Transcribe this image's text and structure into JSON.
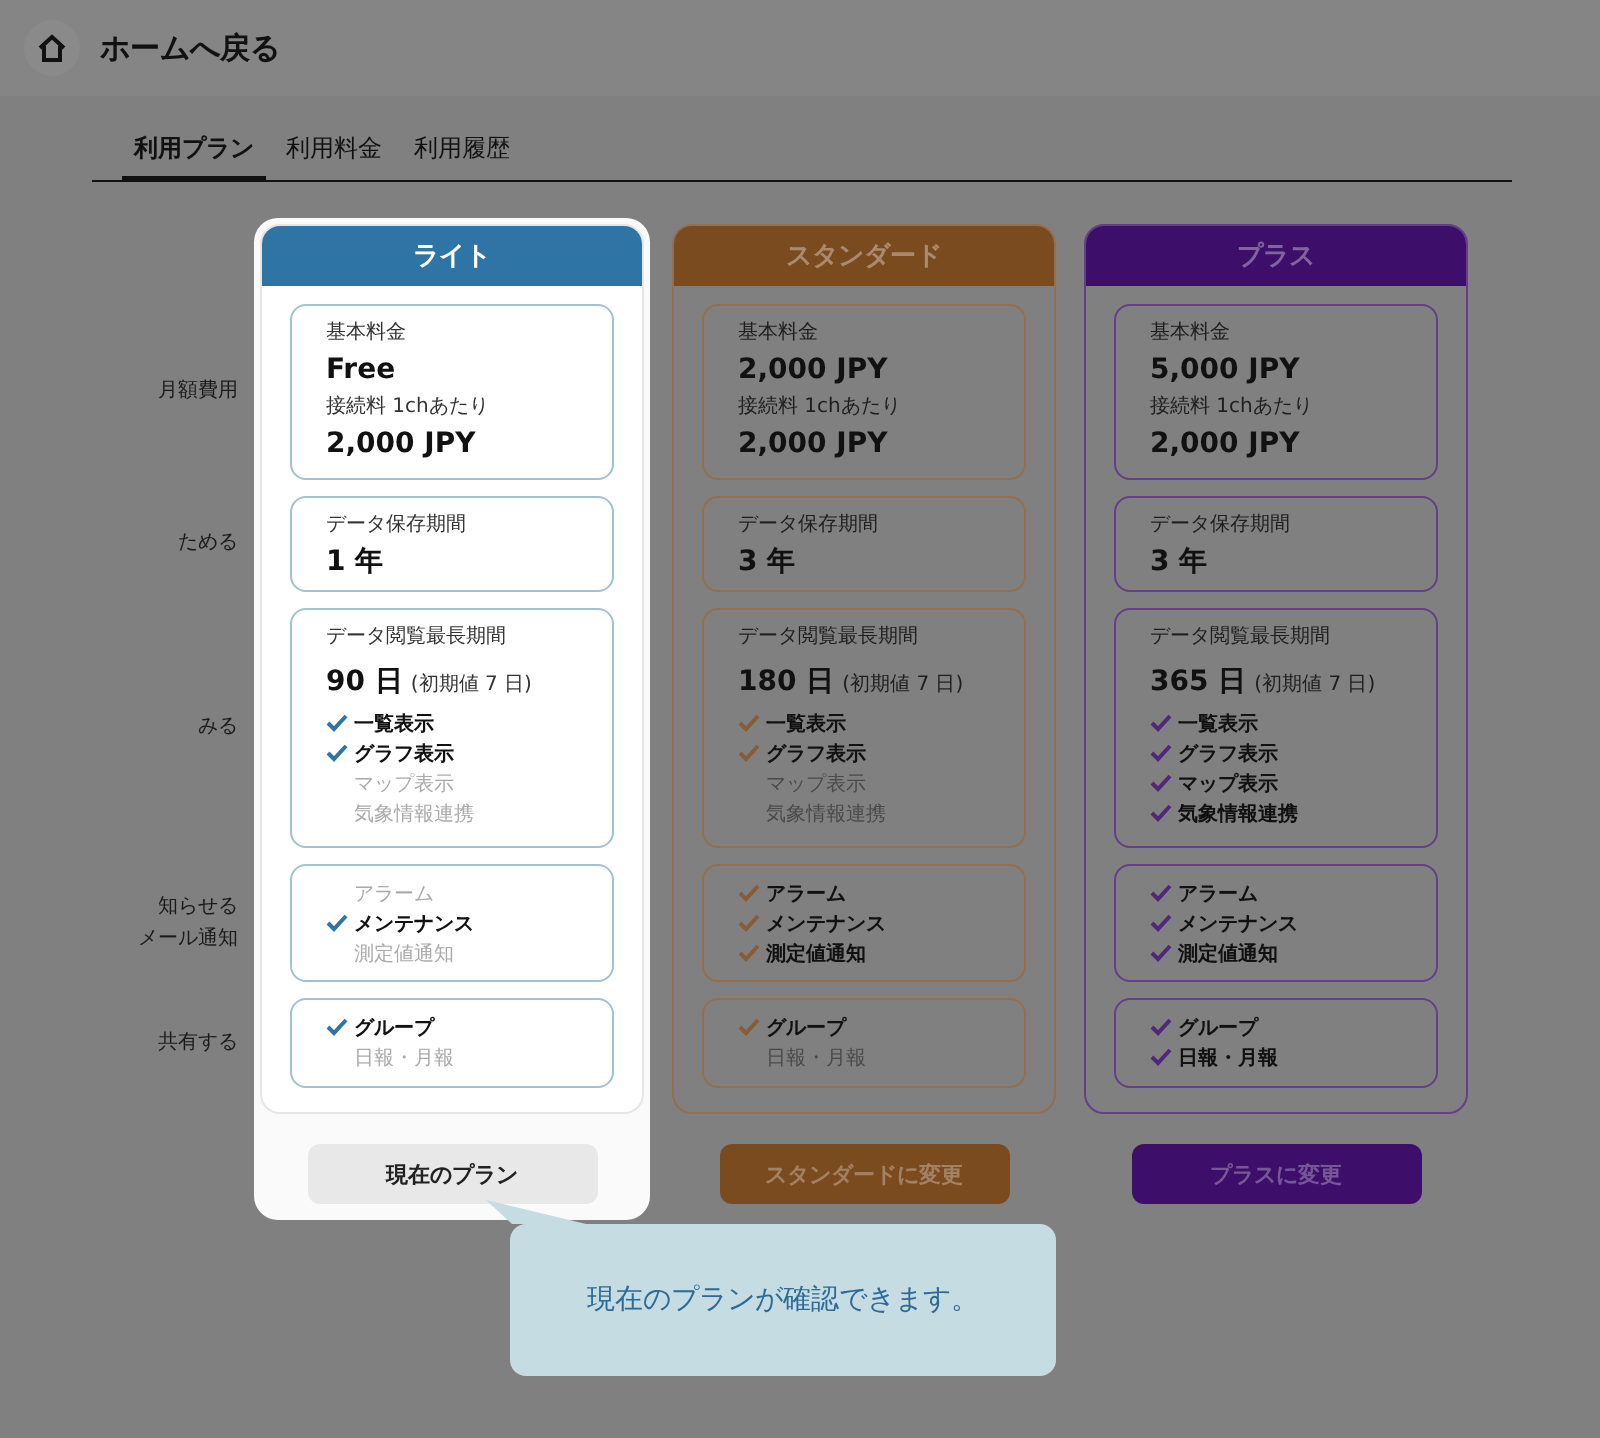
{
  "header": {
    "title": "ホームへ戻る"
  },
  "tabs": [
    {
      "label": "利用プラン",
      "selected": true
    },
    {
      "label": "利用料金",
      "selected": false
    },
    {
      "label": "利用履歴",
      "selected": false
    }
  ],
  "row_labels": [
    [
      "月額費用"
    ],
    [
      "ためる"
    ],
    [
      "みる"
    ],
    [
      "知らせる",
      "メール通知"
    ],
    [
      "共有する"
    ]
  ],
  "plans": [
    {
      "name": "ライト",
      "color": "#2e75a6",
      "highlighted": true,
      "basic": {
        "label": "基本料金",
        "value": "Free",
        "sub_label": "接続料 1chあたり",
        "sub_value": "2,000 JPY"
      },
      "retention": {
        "label": "データ保存期間",
        "value": "1 年"
      },
      "view": {
        "label": "データ閲覧最長期間",
        "value": "90 日",
        "note": "(初期値 7 日)",
        "features": [
          {
            "label": "一覧表示",
            "enabled": true
          },
          {
            "label": "グラフ表示",
            "enabled": true
          },
          {
            "label": "マップ表示",
            "enabled": false
          },
          {
            "label": "気象情報連携",
            "enabled": false
          }
        ]
      },
      "notify": [
        {
          "label": "アラーム",
          "enabled": false
        },
        {
          "label": "メンテナンス",
          "enabled": true
        },
        {
          "label": "測定値通知",
          "enabled": false
        }
      ],
      "share": [
        {
          "label": "グループ",
          "enabled": true
        },
        {
          "label": "日報・月報",
          "enabled": false
        }
      ],
      "button": "現在のプラン"
    },
    {
      "name": "スタンダード",
      "color": "#7b4b20",
      "highlighted": false,
      "basic": {
        "label": "基本料金",
        "value": "2,000 JPY",
        "sub_label": "接続料 1chあたり",
        "sub_value": "2,000 JPY"
      },
      "retention": {
        "label": "データ保存期間",
        "value": "3 年"
      },
      "view": {
        "label": "データ閲覧最長期間",
        "value": "180 日",
        "note": "(初期値 7 日)",
        "features": [
          {
            "label": "一覧表示",
            "enabled": true
          },
          {
            "label": "グラフ表示",
            "enabled": true
          },
          {
            "label": "マップ表示",
            "enabled": false
          },
          {
            "label": "気象情報連携",
            "enabled": false
          }
        ]
      },
      "notify": [
        {
          "label": "アラーム",
          "enabled": true
        },
        {
          "label": "メンテナンス",
          "enabled": true
        },
        {
          "label": "測定値通知",
          "enabled": true
        }
      ],
      "share": [
        {
          "label": "グループ",
          "enabled": true
        },
        {
          "label": "日報・月報",
          "enabled": false
        }
      ],
      "button": "スタンダードに変更"
    },
    {
      "name": "プラス",
      "color": "#3d0f6b",
      "highlighted": false,
      "basic": {
        "label": "基本料金",
        "value": "5,000 JPY",
        "sub_label": "接続料 1chあたり",
        "sub_value": "2,000 JPY"
      },
      "retention": {
        "label": "データ保存期間",
        "value": "3 年"
      },
      "view": {
        "label": "データ閲覧最長期間",
        "value": "365 日",
        "note": "(初期値 7 日)",
        "features": [
          {
            "label": "一覧表示",
            "enabled": true
          },
          {
            "label": "グラフ表示",
            "enabled": true
          },
          {
            "label": "マップ表示",
            "enabled": true
          },
          {
            "label": "気象情報連携",
            "enabled": true
          }
        ]
      },
      "notify": [
        {
          "label": "アラーム",
          "enabled": true
        },
        {
          "label": "メンテナンス",
          "enabled": true
        },
        {
          "label": "測定値通知",
          "enabled": true
        }
      ],
      "share": [
        {
          "label": "グループ",
          "enabled": true
        },
        {
          "label": "日報・月報",
          "enabled": true
        }
      ],
      "button": "プラスに変更"
    }
  ],
  "tooltip": {
    "text": "現在のプランが確認できます。"
  }
}
